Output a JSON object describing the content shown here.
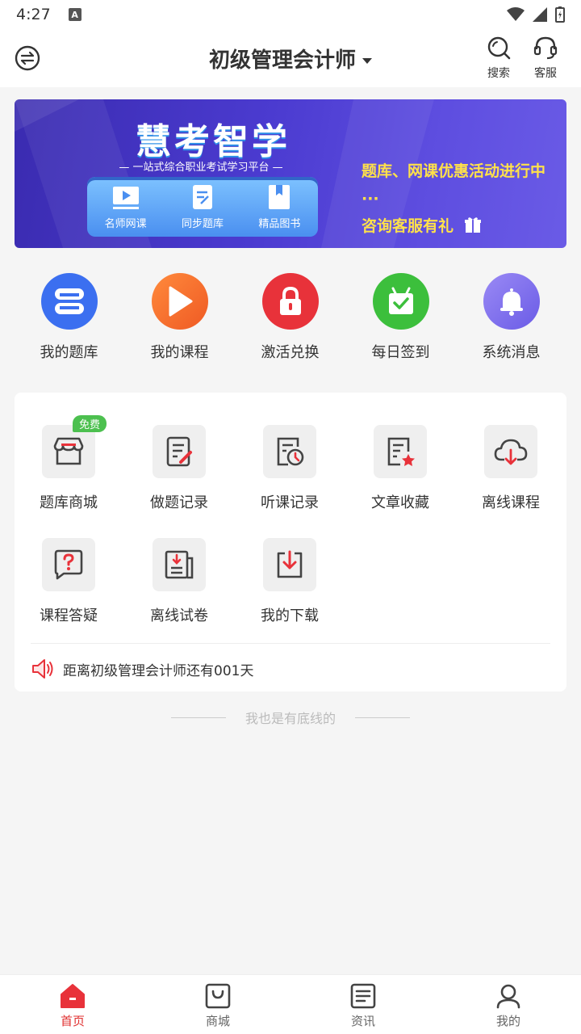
{
  "status": {
    "time": "4:27"
  },
  "header": {
    "title": "初级管理会计师",
    "search_label": "搜索",
    "service_label": "客服"
  },
  "banner": {
    "brand": "慧考智学",
    "tagline": "一站式综合职业考试学习平台",
    "items": [
      "名师网课",
      "同步题库",
      "精品图书"
    ],
    "promo_line1": "题库、网课优惠活动进行中 ···",
    "promo_line2": "咨询客服有礼"
  },
  "quick": [
    {
      "label": "我的题库",
      "icon": "question-bank-icon",
      "color": "#3b6ff0"
    },
    {
      "label": "我的课程",
      "icon": "play-icon",
      "color": "#f26a2a"
    },
    {
      "label": "激活兑换",
      "icon": "lock-icon",
      "color": "#e8323a"
    },
    {
      "label": "每日签到",
      "icon": "check-gift-icon",
      "color": "#3cbf3c"
    },
    {
      "label": "系统消息",
      "icon": "bell-icon",
      "color": "#7b6cf0"
    }
  ],
  "grid": [
    {
      "label": "题库商城",
      "icon": "shop-icon",
      "badge": "免费"
    },
    {
      "label": "做题记录",
      "icon": "edit-record-icon"
    },
    {
      "label": "听课记录",
      "icon": "clock-record-icon"
    },
    {
      "label": "文章收藏",
      "icon": "star-doc-icon"
    },
    {
      "label": "离线课程",
      "icon": "cloud-download-icon"
    },
    {
      "label": "课程答疑",
      "icon": "question-bubble-icon"
    },
    {
      "label": "离线试卷",
      "icon": "paper-download-icon"
    },
    {
      "label": "我的下载",
      "icon": "download-box-icon"
    }
  ],
  "notice": "距离初级管理会计师还有001天",
  "bottom_text": "我也是有底线的",
  "tabs": [
    {
      "label": "首页",
      "active": true
    },
    {
      "label": "商城",
      "active": false
    },
    {
      "label": "资讯",
      "active": false
    },
    {
      "label": "我的",
      "active": false
    }
  ],
  "colors": {
    "accent": "#e02f2f",
    "badge": "#4cc04f",
    "promo": "#ffe14a"
  }
}
